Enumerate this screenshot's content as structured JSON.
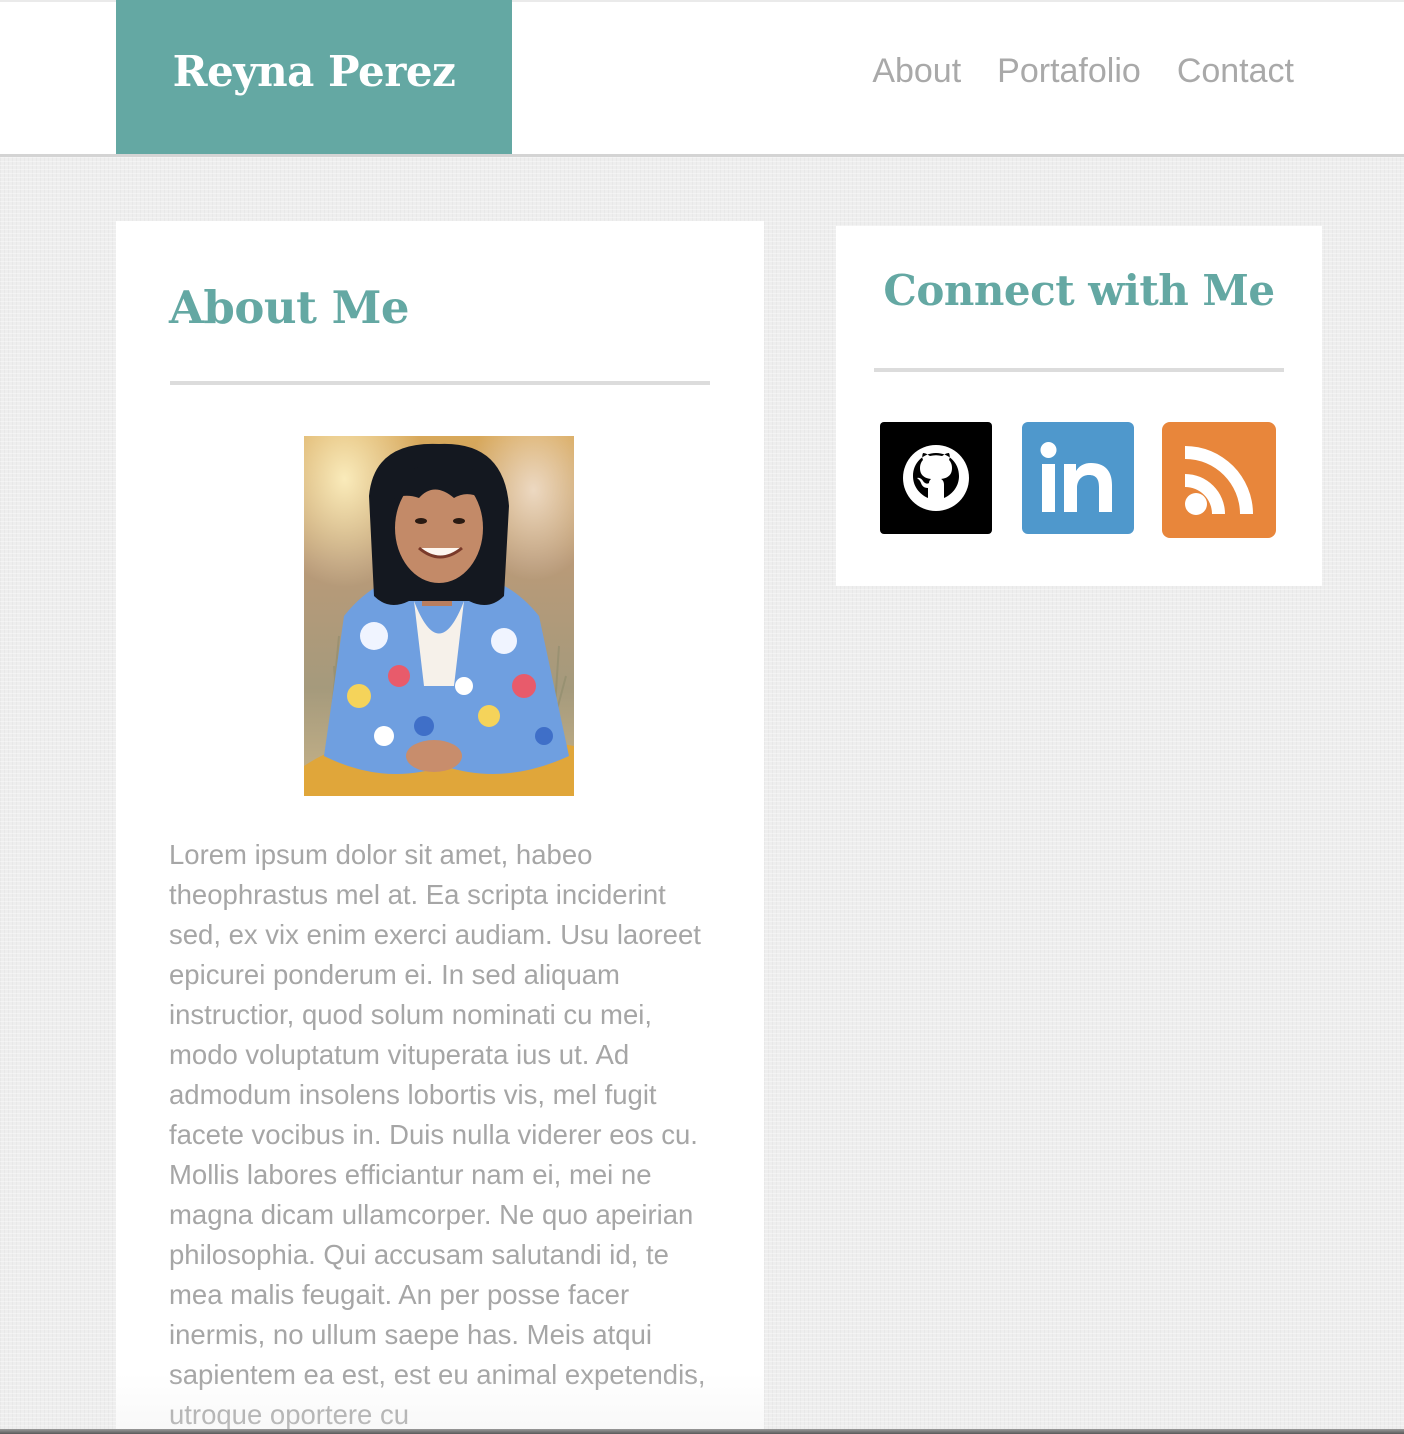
{
  "header": {
    "logo": "Reyna Perez",
    "nav": [
      "About",
      "Portafolio",
      "Contact"
    ]
  },
  "about": {
    "title": "About Me",
    "paragraph": "Lorem ipsum dolor sit amet, habeo theophrastus mel at. Ea scripta inciderint sed, ex vix enim exerci audiam. Usu laoreet epicurei ponderum ei. In sed aliquam instructior, quod solum nominati cu mei, modo voluptatum vituperata ius ut. Ad admodum insolens lobortis vis, mel fugit facete vocibus in. Duis nulla viderer eos cu. Mollis labores efficiantur nam ei, mei ne magna dicam ullamcorper. Ne quo apeirian philosophia. Qui accusam salutandi id, te mea malis feugait. An per posse facer inermis, no ullum saepe has. Meis atqui sapientem ea est, est eu animal expetendis, utroque oportere cu"
  },
  "connect": {
    "title": "Connect with Me",
    "icons": [
      "github-icon",
      "linkedin-icon",
      "rss-icon"
    ]
  },
  "colors": {
    "accent": "#64a8a3",
    "nav_text": "#a9a9a9",
    "body_text": "#a6a6a6",
    "github": "#000000",
    "linkedin": "#4f98cc",
    "rss": "#e8863b"
  }
}
